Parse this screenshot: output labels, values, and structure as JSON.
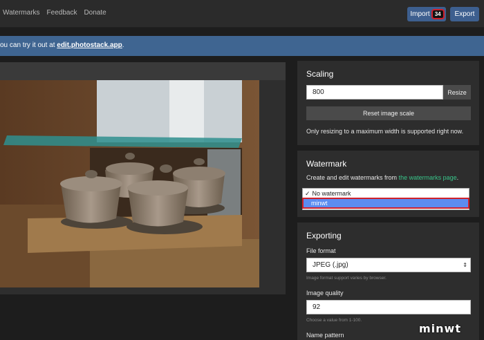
{
  "nav": {
    "items": [
      "Watermarks",
      "Feedback",
      "Donate"
    ]
  },
  "toolbar": {
    "import_label": "Import",
    "import_count": "34",
    "export_label": "Export"
  },
  "banner": {
    "prefix": "ou can try it out at ",
    "link": "edit.photostack.app",
    "suffix": "."
  },
  "scaling": {
    "title": "Scaling",
    "width_value": "800",
    "resize_label": "Resize",
    "reset_label": "Reset image scale",
    "note": "Only resizing to a maximum width is supported right now."
  },
  "watermark": {
    "title": "Watermark",
    "desc_prefix": "Create and edit watermarks from ",
    "desc_link": "the watermarks page",
    "desc_suffix": ".",
    "options": [
      "No watermark",
      "minwt"
    ],
    "checked_option": "✓",
    "selected": "minwt"
  },
  "exporting": {
    "title": "Exporting",
    "format_label": "File format",
    "format_value": "JPEG (.jpg)",
    "format_hint": "Image format support varies by browser.",
    "quality_label": "Image quality",
    "quality_value": "92",
    "quality_hint": "Choose a value from 1-100.",
    "name_label": "Name pattern"
  },
  "brand": {
    "site_watermark": "minwt"
  },
  "colors": {
    "primary": "#3d5f8f",
    "banner": "#3f6591",
    "link": "#39c58a",
    "highlight": "#d0202a"
  }
}
